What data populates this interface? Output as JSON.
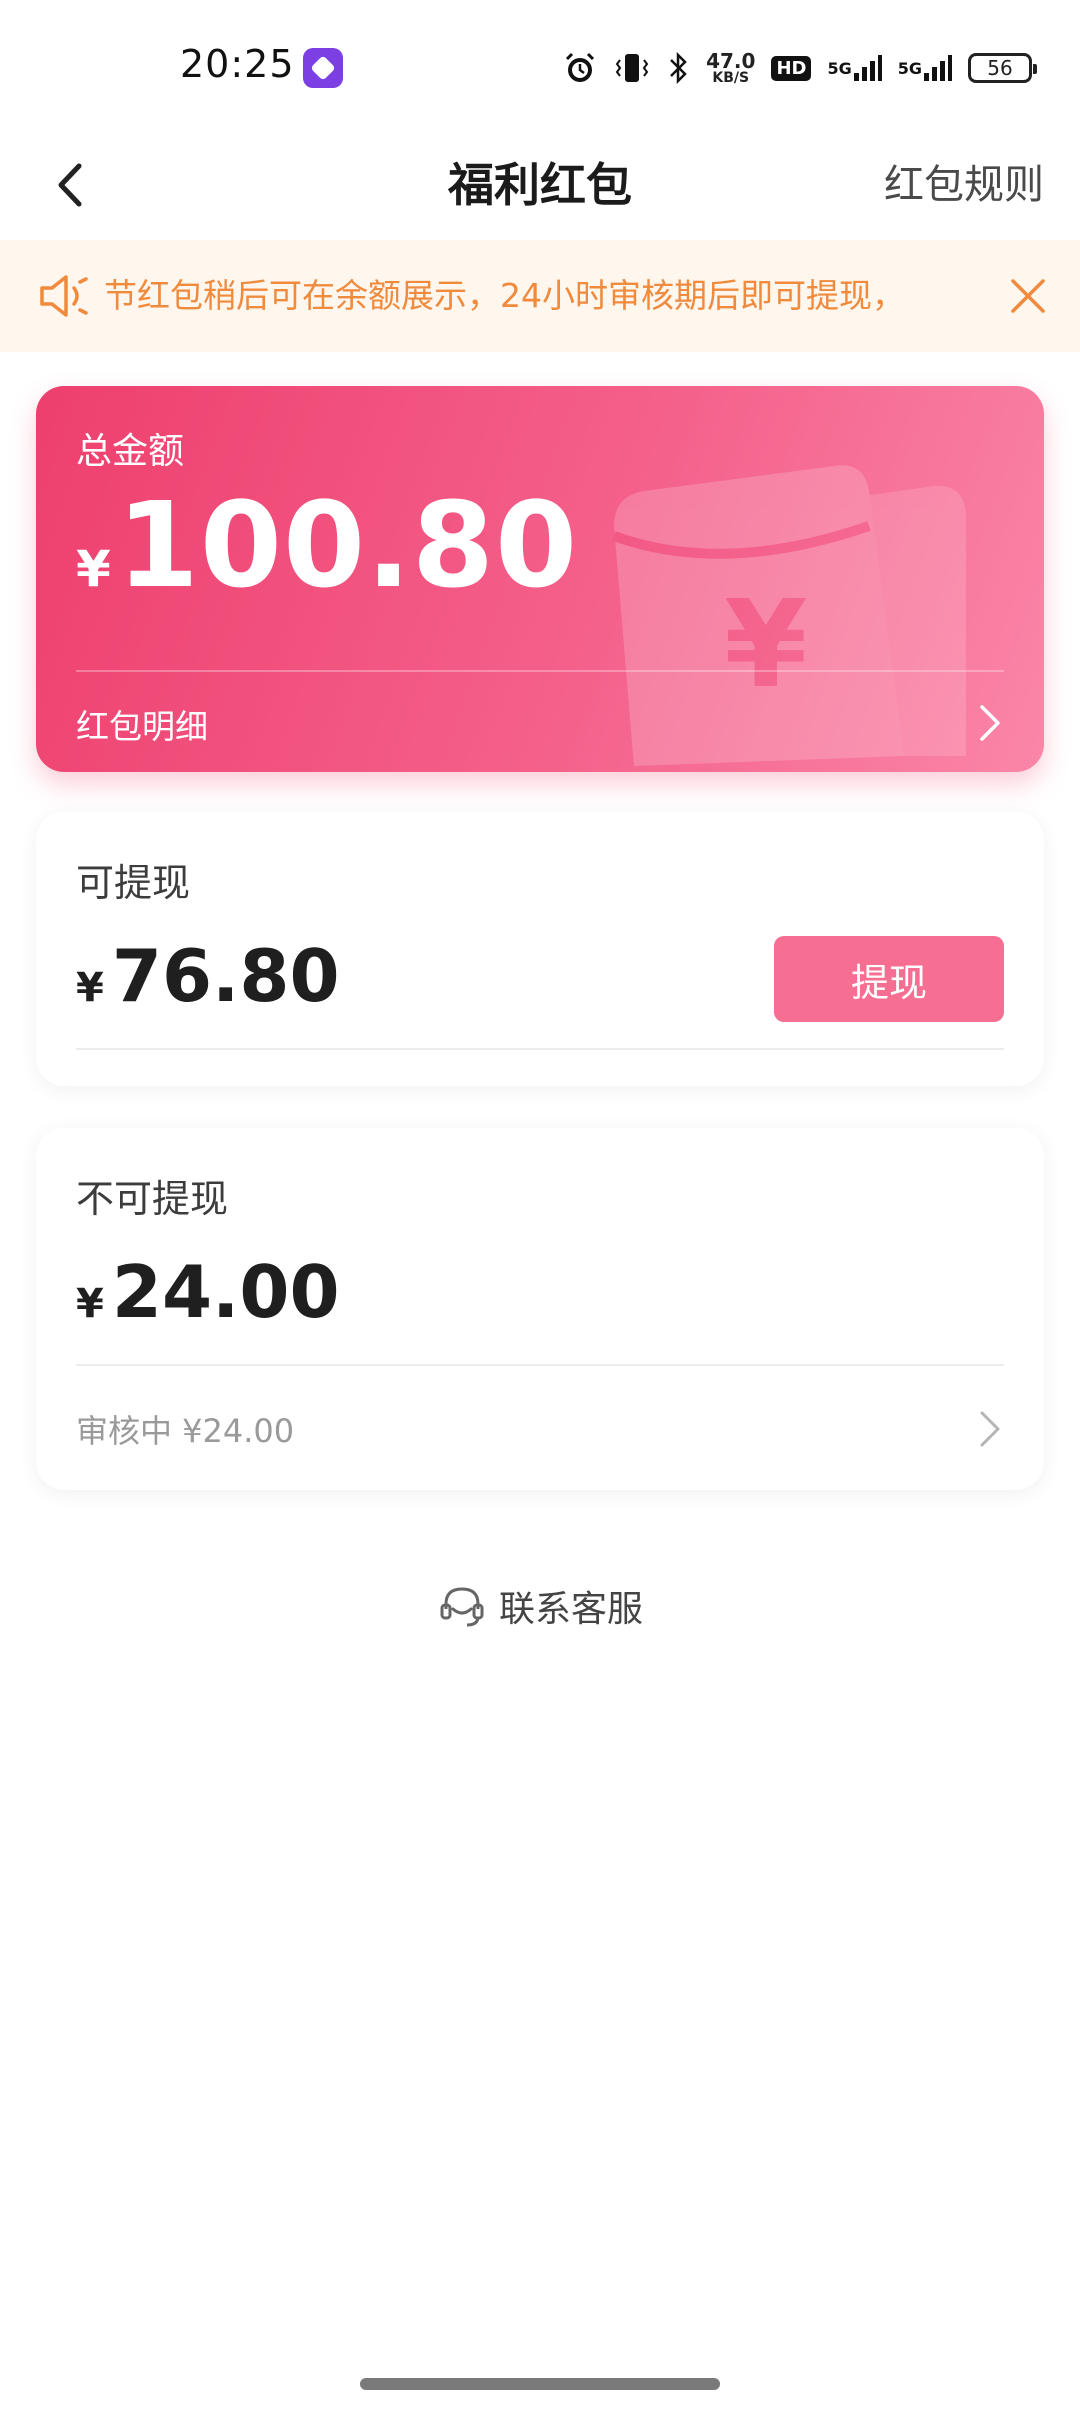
{
  "status_bar": {
    "time": "20:25",
    "app_icon": "app-shortcut-icon",
    "net_speed_value": "47.0",
    "net_speed_unit": "KB/S",
    "hd_label": "HD",
    "network1_label": "5G",
    "network2_label": "5G",
    "battery_level": "56",
    "icons": [
      "alarm-icon",
      "vibrate-icon",
      "bluetooth-icon",
      "signal-icon",
      "battery-icon"
    ]
  },
  "header": {
    "title": "福利红包",
    "rules_link": "红包规则",
    "back_icon": "back-arrow-icon"
  },
  "notice": {
    "text": "节红包稍后可在余额展示，24小时审核期后即可提现，",
    "icon": "speaker-icon",
    "close_icon": "close-icon",
    "color": "#f08a3c"
  },
  "total_card": {
    "label": "总金额",
    "currency": "¥",
    "amount": "100.80",
    "detail_link": "红包明细",
    "colors": [
      "#ee3f6e",
      "#fa86a8"
    ]
  },
  "withdrawable_card": {
    "title": "可提现",
    "currency": "¥",
    "amount": "76.80",
    "button_label": "提现",
    "button_color": "#f66e91"
  },
  "non_withdrawable_card": {
    "title": "不可提现",
    "currency": "¥",
    "amount": "24.00",
    "review_text": "审核中 ¥24.00"
  },
  "support": {
    "label": "联系客服",
    "icon": "headset-icon"
  }
}
